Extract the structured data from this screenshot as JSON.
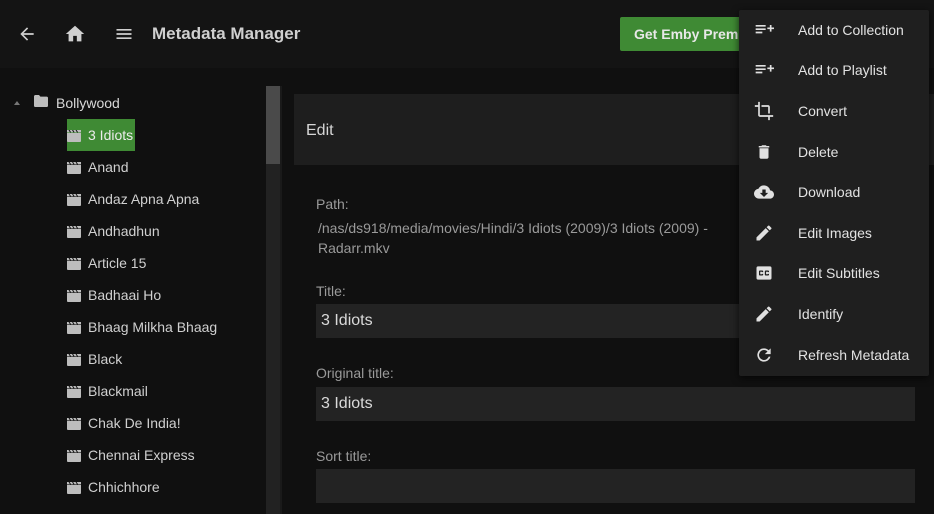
{
  "header": {
    "title": "Metadata Manager",
    "premiere_label": "Get Emby Premiere",
    "back_icon": "arrow-left-icon",
    "home_icon": "home-icon",
    "menu_icon": "hamburger-menu-icon"
  },
  "tree": {
    "root_label": "Bollywood",
    "items": [
      {
        "label": "3 Idiots",
        "selected": true
      },
      {
        "label": "Anand"
      },
      {
        "label": "Andaz Apna Apna"
      },
      {
        "label": "Andhadhun"
      },
      {
        "label": "Article 15"
      },
      {
        "label": "Badhaai Ho"
      },
      {
        "label": "Bhaag Milkha Bhaag"
      },
      {
        "label": "Black"
      },
      {
        "label": "Blackmail"
      },
      {
        "label": "Chak De India!"
      },
      {
        "label": "Chennai Express"
      },
      {
        "label": "Chhichhore"
      }
    ]
  },
  "edit": {
    "heading": "Edit",
    "path_label": "Path:",
    "path_value": "/nas/ds918/media/movies/Hindi/3 Idiots (2009)/3 Idiots (2009) - Radarr.mkv",
    "title_label": "Title:",
    "title_value": "3 Idiots",
    "original_title_label": "Original title:",
    "original_title_value": "3 Idiots",
    "sort_title_label": "Sort title:",
    "sort_title_value": ""
  },
  "context_menu": {
    "items": [
      {
        "label": "Add to Collection",
        "icon": "playlist-add-icon"
      },
      {
        "label": "Add to Playlist",
        "icon": "playlist-add-icon"
      },
      {
        "label": "Convert",
        "icon": "crop-icon"
      },
      {
        "label": "Delete",
        "icon": "trash-icon"
      },
      {
        "label": "Download",
        "icon": "cloud-download-icon"
      },
      {
        "label": "Edit Images",
        "icon": "pencil-icon"
      },
      {
        "label": "Edit Subtitles",
        "icon": "closed-caption-icon"
      },
      {
        "label": "Identify",
        "icon": "pencil-icon"
      },
      {
        "label": "Refresh Metadata",
        "icon": "refresh-icon"
      }
    ]
  },
  "colors": {
    "accent_green": "#3f8a34",
    "background": "#101010",
    "panel": "#1e1e1e",
    "menu": "#1f1f1f"
  }
}
